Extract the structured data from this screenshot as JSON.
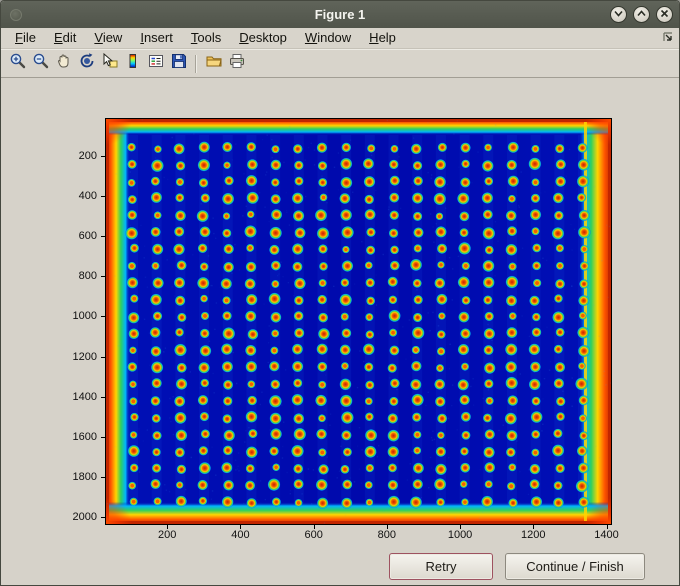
{
  "window": {
    "title": "Figure 1",
    "controls": [
      {
        "name": "shade",
        "icon": "chevron-down-icon"
      },
      {
        "name": "unshade",
        "icon": "chevron-up-icon"
      },
      {
        "name": "close",
        "icon": "close-icon"
      }
    ]
  },
  "menu_bar": {
    "items": [
      "File",
      "Edit",
      "View",
      "Insert",
      "Tools",
      "Desktop",
      "Window",
      "Help"
    ],
    "dock_icon": "dock-arrow-icon"
  },
  "toolbar": {
    "buttons": [
      "zoom-in",
      "zoom-out",
      "pan",
      "rotate-3d",
      "data-cursor",
      "insert-colorbar",
      "insert-legend",
      "save-figure",
      "open-file",
      "print-figure"
    ]
  },
  "plot": {
    "type": "image",
    "description": "Microarray scan shown with jet colormap: dense grid of red/orange spots (about 20 columns by 22 rows) on a blue background with bright red/orange saturated borders around the slide edges",
    "x_ticks": [
      200,
      400,
      600,
      800,
      1000,
      1200,
      1400
    ],
    "y_ticks": [
      200,
      400,
      600,
      800,
      1000,
      1200,
      1400,
      1600,
      1800,
      2000
    ],
    "x_range": [
      30,
      1415
    ],
    "y_range": [
      10,
      2040
    ],
    "image": {
      "background": "#0009ac",
      "grid": {
        "cols": 20,
        "rows": 22
      },
      "edge_colors": [
        "#c22600",
        "#ff5500",
        "#ffd400",
        "#2fd060",
        "#00b4ff"
      ],
      "spot_colors": [
        "#c81e00",
        "#f06000",
        "#ffc800",
        "#46d24a",
        "#00b4f0"
      ]
    }
  },
  "actions": {
    "retry_label": "Retry",
    "continue_label": "Continue / Finish"
  }
}
